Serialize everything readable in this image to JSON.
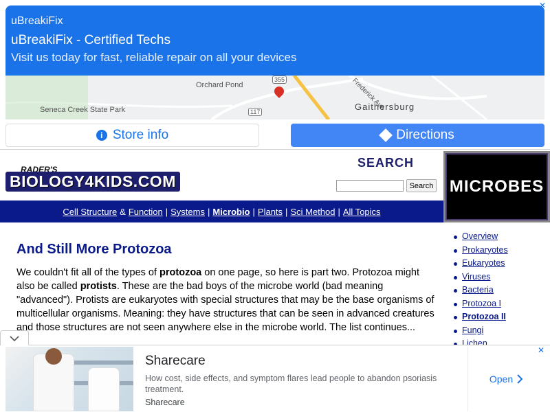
{
  "top_ad": {
    "brand": "uBreakiFix",
    "headline": "uBreakiFix - Certified Techs",
    "subtitle": "Visit us today for fast, reliable repair on all your devices",
    "map_labels": {
      "pond": "Orchard Pond",
      "park": "Seneca Creek State Park",
      "road": "117",
      "road2": "355",
      "avenue": "Frederick Ave",
      "city": "Gaithersburg"
    },
    "store_info_label": "Store info",
    "directions_label": "Directions",
    "close_icon": "close-icon"
  },
  "header": {
    "logo_small": "RADER'S",
    "logo_big": "BIOLOGY4KIDS.COM",
    "search_title": "SEARCH",
    "search_button": "Search",
    "section_badge": "MICROBES"
  },
  "nav": {
    "cell_structure": "Cell Structure",
    "amp": "&",
    "function": "Function",
    "systems": "Systems",
    "microbio": "Microbio",
    "plants": "Plants",
    "sci_method": "Sci Method",
    "all_topics": "All Topics",
    "sep": "|"
  },
  "main": {
    "title": "And Still More Protozoa",
    "p1": "We couldn't fit all of the types of ",
    "b1": "protozoa",
    "p2": " on one page, so here is part two. Protozoa might also be called ",
    "b2": "protists",
    "p3": ". These are the bad boys of the microbe world (bad meaning \"advanced\"). Protists are eukaryotes with special structures that may be the base organisms of multicellular organisms. Meaning: they have structures that can be seen in advanced creatures and those structures are not seen anywhere else in the microbe world. The list continues..."
  },
  "side_nav": {
    "items": [
      {
        "label": "Overview"
      },
      {
        "label": "Prokaryotes"
      },
      {
        "label": "Eukaryotes"
      },
      {
        "label": "Viruses"
      },
      {
        "label": "Bacteria"
      },
      {
        "label": "Protozoa I"
      },
      {
        "label": "Protozoa II"
      },
      {
        "label": "Fungi"
      },
      {
        "label": "Lichen"
      }
    ]
  },
  "bottom_ad": {
    "title": "Sharecare",
    "description": "How cost, side effects, and symptom flares lead people to abandon psoriasis treatment.",
    "source": "Sharecare",
    "open_label": "Open"
  },
  "colors": {
    "ad_blue": "#1a73e8",
    "nav_blue": "#0a1a8a"
  }
}
